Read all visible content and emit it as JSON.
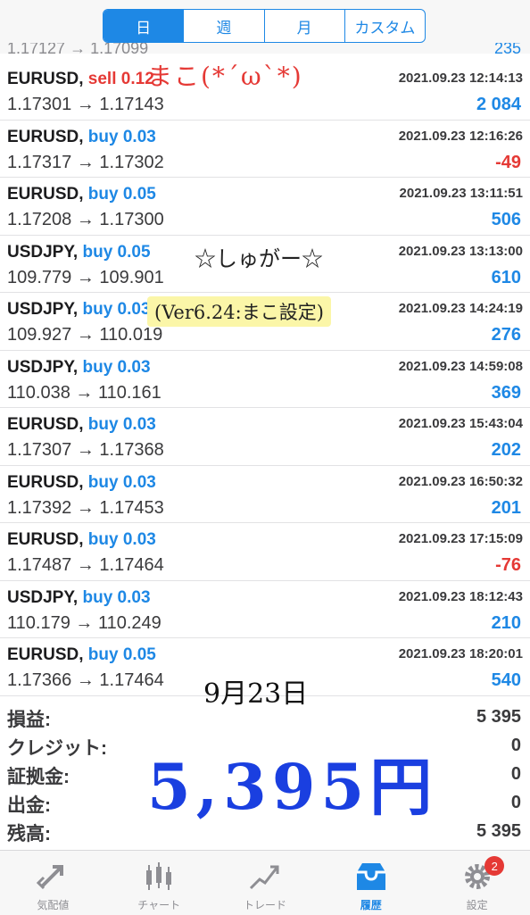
{
  "period_tabs": [
    "日",
    "週",
    "月",
    "カスタム"
  ],
  "active_tab_index": 0,
  "partial_row": {
    "text": "1.17127 → 1.17099",
    "profit": "235"
  },
  "trades": [
    {
      "symbol": "EURUSD,",
      "side": "sell",
      "lots": "0.12",
      "time": "2021.09.23 12:14:13",
      "open": "1.17301",
      "close": "1.17143",
      "profit": "2 084",
      "sign": "pos"
    },
    {
      "symbol": "EURUSD,",
      "side": "buy",
      "lots": "0.03",
      "time": "2021.09.23 12:16:26",
      "open": "1.17317",
      "close": "1.17302",
      "profit": "-49",
      "sign": "neg"
    },
    {
      "symbol": "EURUSD,",
      "side": "buy",
      "lots": "0.05",
      "time": "2021.09.23 13:11:51",
      "open": "1.17208",
      "close": "1.17300",
      "profit": "506",
      "sign": "pos"
    },
    {
      "symbol": "USDJPY,",
      "side": "buy",
      "lots": "0.05",
      "time": "2021.09.23 13:13:00",
      "open": "109.779",
      "close": "109.901",
      "profit": "610",
      "sign": "pos"
    },
    {
      "symbol": "USDJPY,",
      "side": "buy",
      "lots": "0.03",
      "time": "2021.09.23 14:24:19",
      "open": "109.927",
      "close": "110.019",
      "profit": "276",
      "sign": "pos"
    },
    {
      "symbol": "USDJPY,",
      "side": "buy",
      "lots": "0.03",
      "time": "2021.09.23 14:59:08",
      "open": "110.038",
      "close": "110.161",
      "profit": "369",
      "sign": "pos"
    },
    {
      "symbol": "EURUSD,",
      "side": "buy",
      "lots": "0.03",
      "time": "2021.09.23 15:43:04",
      "open": "1.17307",
      "close": "1.17368",
      "profit": "202",
      "sign": "pos"
    },
    {
      "symbol": "EURUSD,",
      "side": "buy",
      "lots": "0.03",
      "time": "2021.09.23 16:50:32",
      "open": "1.17392",
      "close": "1.17453",
      "profit": "201",
      "sign": "pos"
    },
    {
      "symbol": "EURUSD,",
      "side": "buy",
      "lots": "0.03",
      "time": "2021.09.23 17:15:09",
      "open": "1.17487",
      "close": "1.17464",
      "profit": "-76",
      "sign": "neg"
    },
    {
      "symbol": "USDJPY,",
      "side": "buy",
      "lots": "0.03",
      "time": "2021.09.23 18:12:43",
      "open": "110.179",
      "close": "110.249",
      "profit": "210",
      "sign": "pos"
    },
    {
      "symbol": "EURUSD,",
      "side": "buy",
      "lots": "0.05",
      "time": "2021.09.23 18:20:01",
      "open": "1.17366",
      "close": "1.17464",
      "profit": "540",
      "sign": "pos"
    }
  ],
  "summary": [
    {
      "label": "損益:",
      "value": "5 395"
    },
    {
      "label": "クレジット:",
      "value": "0"
    },
    {
      "label": "証拠金:",
      "value": "0"
    },
    {
      "label": "出金:",
      "value": "0"
    },
    {
      "label": "残高:",
      "value": "5 395"
    }
  ],
  "annotations": {
    "name_note": "まこ(*´ω`*)",
    "sugar_note": "☆しゅがー☆",
    "version_note": "(Ver6.24:まこ設定)",
    "date_note": "9月23日",
    "total_note": "5,395円"
  },
  "bottom_tabs": [
    {
      "label": "気配値",
      "icon": "quotes-icon"
    },
    {
      "label": "チャート",
      "icon": "chart-icon"
    },
    {
      "label": "トレード",
      "icon": "trade-icon"
    },
    {
      "label": "履歴",
      "icon": "history-icon"
    },
    {
      "label": "設定",
      "icon": "settings-icon"
    }
  ],
  "active_bottom_tab": 3,
  "settings_badge": "2",
  "colors": {
    "accent": "#1e88e5",
    "negative": "#e53935",
    "handwriting_blue": "#1a3fe0"
  }
}
